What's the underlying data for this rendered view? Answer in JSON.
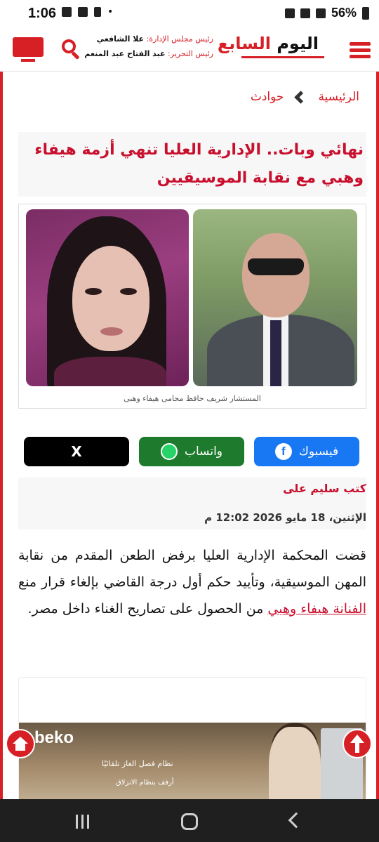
{
  "status_bar": {
    "time": "1:06",
    "battery": "56%"
  },
  "header": {
    "logo_main": "اليوم",
    "logo_accent": "السابع",
    "chairman_role": "رئيس مجلس الإدارة:",
    "chairman_name": "علا الشافعي",
    "editor_role": "رئيس التحرير:",
    "editor_name": "عبد الفتاح عبد المنعم"
  },
  "breadcrumb": {
    "home": "الرئيسية",
    "section": "حوادث"
  },
  "article": {
    "title": "نهائي وبات.. الإدارية العليا تنهي أزمة هيفاء وهبي مع نقابة الموسيقيين",
    "image_caption": "المستشار شريف حافظ محامى هيفاء وهبى",
    "author": "كتب سليم على",
    "date": "الإثنين، 18 مايو 2026 12:02 م",
    "body_part1": "قضت المحكمة الإدارية العليا برفض الطعن المقدم من نقابة المهن الموسيقية، وتأييد حكم أول درجة القاضي بإلغاء قرار منع ",
    "body_link": "الفنانة هيفاء وهبي",
    "body_part2": " من الحصول على تصاريح الغناء داخل مصر."
  },
  "share": {
    "facebook": "فيسبوك",
    "whatsapp": "واتساب",
    "x": "X"
  },
  "ad": {
    "brand": "beko",
    "line1": "نظام فصل الغاز تلقائيًا",
    "line2": "أرفف بنظام الانزلاق"
  },
  "colors": {
    "brand_red": "#d71f26",
    "title_red": "#c8102e",
    "facebook_blue": "#1877f2",
    "whatsapp_green": "#1e7b2d"
  }
}
